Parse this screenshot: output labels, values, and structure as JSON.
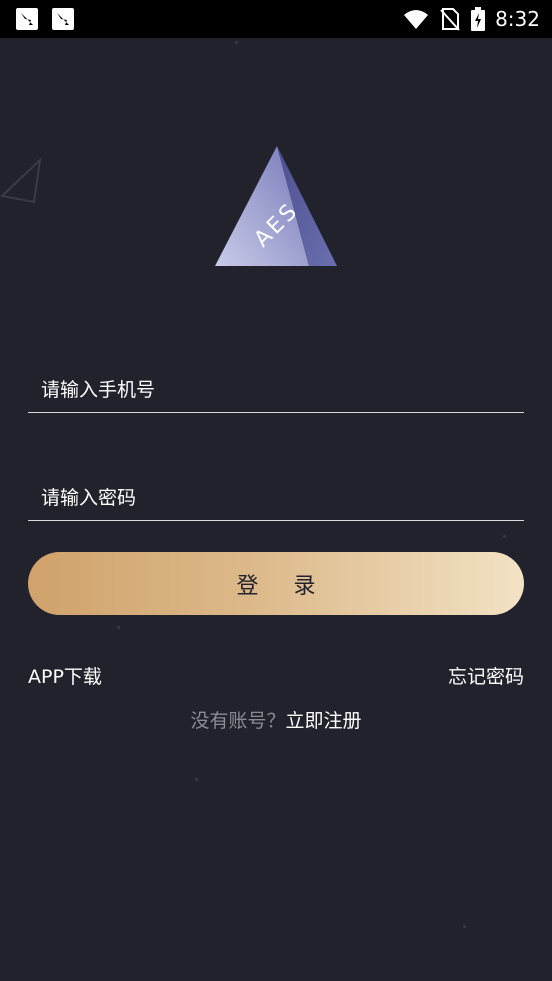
{
  "status_bar": {
    "time": "8:32",
    "icons": [
      "notification-app-icon",
      "notification-app-icon",
      "wifi-icon",
      "no-sim-icon",
      "battery-charging-icon"
    ]
  },
  "logo": {
    "text": "AES"
  },
  "form": {
    "phone_placeholder": "请输入手机号",
    "password_placeholder": "请输入密码",
    "login_label": "登 录"
  },
  "links": {
    "app_download": "APP下载",
    "forgot_password": "忘记密码",
    "register_prompt": "没有账号？",
    "register_link": "立即注册"
  },
  "colors": {
    "background": "#22222d",
    "button_gradient_start": "#d0a26b",
    "button_gradient_end": "#f2e2c4",
    "muted_text": "#8b8b93"
  }
}
